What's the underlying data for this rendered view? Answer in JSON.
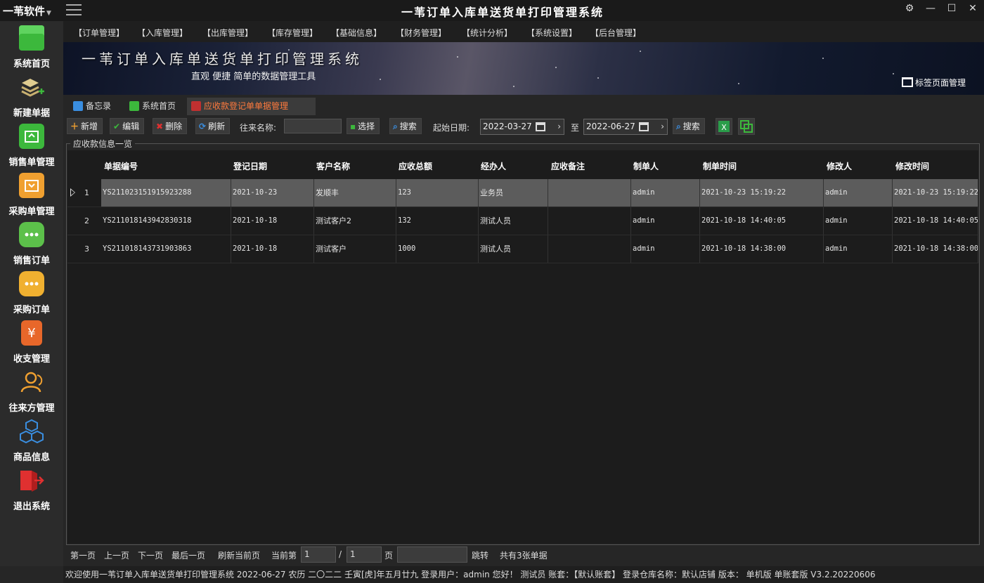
{
  "brand": "一苇软件",
  "app_title": "一苇订单入库单送货单打印管理系统",
  "sidebar": {
    "items": [
      {
        "label": "系统首页",
        "icon": "cube-icon",
        "color": "#3cb83c"
      },
      {
        "label": "新建单据",
        "icon": "layers-add-icon",
        "color": "#d8c48a"
      },
      {
        "label": "销售单管理",
        "icon": "box-up-icon",
        "color": "#3cb83c"
      },
      {
        "label": "采购单管理",
        "icon": "box-down-icon",
        "color": "#f0a030"
      },
      {
        "label": "销售订单",
        "icon": "dots-icon",
        "color": "#5cc04a"
      },
      {
        "label": "采购订单",
        "icon": "dots-icon",
        "color": "#f0b030"
      },
      {
        "label": "收支管理",
        "icon": "yen-icon",
        "color": "#e8672a"
      },
      {
        "label": "往来方管理",
        "icon": "users-icon",
        "color": "#f0a030"
      },
      {
        "label": "商品信息",
        "icon": "cubes-icon",
        "color": "#3a8ee0"
      },
      {
        "label": "退出系统",
        "icon": "exit-icon",
        "color": "#e03030"
      }
    ]
  },
  "menu": [
    "【订单管理】",
    "【入库管理】",
    "【出库管理】",
    "【库存管理】",
    "【基础信息】",
    "【财务管理】",
    "【统计分析】",
    "【系统设置】",
    "【后台管理】"
  ],
  "banner": {
    "title": "一苇订单入库单送货单打印管理系统",
    "subtitle": "直观 便捷 简单的数据管理工具",
    "tab_manager": "标签页面管理"
  },
  "tabs": [
    {
      "label": "备忘录",
      "active": false
    },
    {
      "label": "系统首页",
      "active": false
    },
    {
      "label": "应收款登记单单据管理",
      "active": true
    }
  ],
  "toolbar": {
    "add": "新增",
    "edit": "编辑",
    "delete": "删除",
    "refresh": "刷新",
    "party_label": "往来名称:",
    "party_value": "",
    "select": "选择",
    "search1": "搜索",
    "start_date_label": "起始日期:",
    "start_date": "2022-03-27",
    "to": "至",
    "end_date": "2022-06-27",
    "search2": "搜索"
  },
  "group_title": "应收款信息一览",
  "table": {
    "columns": [
      "单据编号",
      "登记日期",
      "客户名称",
      "应收总额",
      "经办人",
      "应收备注",
      "制单人",
      "制单时间",
      "修改人",
      "修改时间"
    ],
    "rows": [
      {
        "num": "1",
        "cells": [
          "YS211023151915923288",
          "2021-10-23",
          "发顺丰",
          "123",
          "业务员",
          "",
          "admin",
          "2021-10-23 15:19:22",
          "admin",
          "2021-10-23 15:19:22"
        ]
      },
      {
        "num": "2",
        "cells": [
          "YS211018143942830318",
          "2021-10-18",
          "测试客户2",
          "132",
          "测试人员",
          "",
          "admin",
          "2021-10-18 14:40:05",
          "admin",
          "2021-10-18 14:40:05"
        ]
      },
      {
        "num": "3",
        "cells": [
          "YS211018143731903863",
          "2021-10-18",
          "测试客户",
          "1000",
          "测试人员",
          "",
          "admin",
          "2021-10-18 14:38:00",
          "admin",
          "2021-10-18 14:38:00"
        ]
      }
    ]
  },
  "pager": {
    "first": "第一页",
    "prev": "上一页",
    "next": "下一页",
    "last": "最后一页",
    "refresh": "刷新当前页",
    "current_label": "当前第",
    "current": "1",
    "slash": "/",
    "total_pages": "1",
    "page_unit": "页",
    "jump_value": "",
    "jump": "跳转",
    "total": "共有3张单据"
  },
  "status": "欢迎使用一苇订单入库单送货单打印管理系统 2022-06-27 农历 二〇二二 壬寅[虎]年五月廿九 登录用户：admin 您好！ 测试员 账套：【默认账套】 登录仓库名称：默认店铺 版本： 单机版 单账套版 V3.2.20220606"
}
